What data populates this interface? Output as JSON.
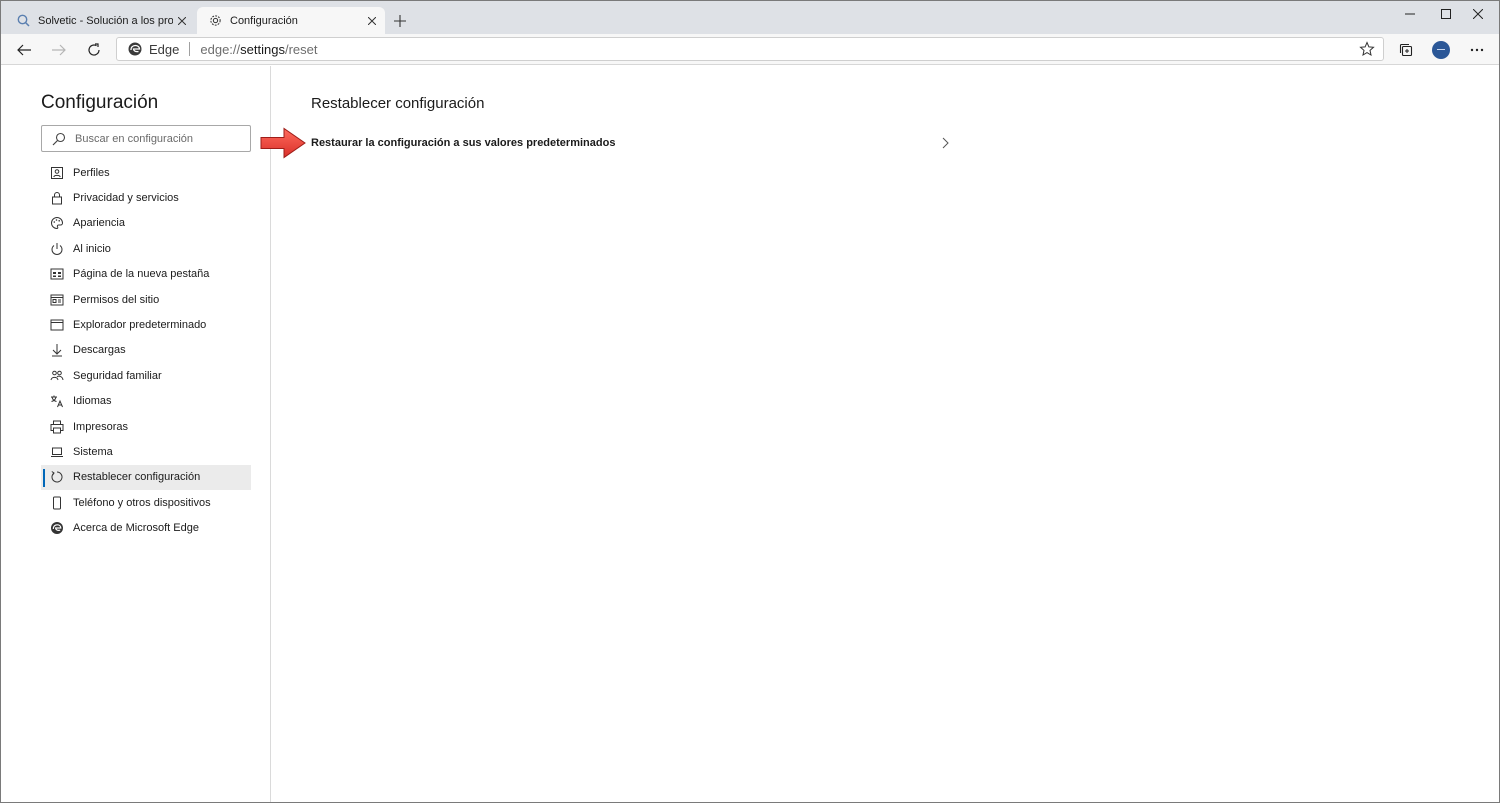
{
  "browser": {
    "tabs": [
      {
        "title": "Solvetic - Solución a los problem",
        "favicon": "search-q-icon",
        "active": false
      },
      {
        "title": "Configuración",
        "favicon": "gear-icon",
        "active": true
      }
    ],
    "address_bar": {
      "site_name": "Edge",
      "url_scheme": "edge://",
      "url_host": "settings",
      "url_path": "/reset"
    }
  },
  "sidebar": {
    "title": "Configuración",
    "search_placeholder": "Buscar en configuración",
    "items": [
      {
        "label": "Perfiles",
        "icon": "profile-icon"
      },
      {
        "label": "Privacidad y servicios",
        "icon": "lock-icon"
      },
      {
        "label": "Apariencia",
        "icon": "palette-icon"
      },
      {
        "label": "Al inicio",
        "icon": "power-icon"
      },
      {
        "label": "Página de la nueva pestaña",
        "icon": "newtab-page-icon"
      },
      {
        "label": "Permisos del sitio",
        "icon": "site-permissions-icon"
      },
      {
        "label": "Explorador predeterminado",
        "icon": "browser-window-icon"
      },
      {
        "label": "Descargas",
        "icon": "download-icon"
      },
      {
        "label": "Seguridad familiar",
        "icon": "family-icon"
      },
      {
        "label": "Idiomas",
        "icon": "language-icon"
      },
      {
        "label": "Impresoras",
        "icon": "printer-icon"
      },
      {
        "label": "Sistema",
        "icon": "laptop-icon"
      },
      {
        "label": "Restablecer configuración",
        "icon": "reset-icon",
        "selected": true
      },
      {
        "label": "Teléfono y otros dispositivos",
        "icon": "phone-icon"
      },
      {
        "label": "Acerca de Microsoft Edge",
        "icon": "edge-logo-icon"
      }
    ]
  },
  "main": {
    "title": "Restablecer configuración",
    "reset_row_label": "Restaurar la configuración a sus valores predeterminados"
  },
  "colors": {
    "accent": "#0067b8",
    "annotation_arrow": "#e8453c",
    "selected_bg": "#ebebeb"
  }
}
